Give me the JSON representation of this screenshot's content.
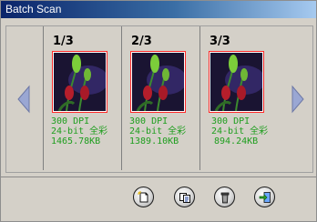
{
  "window": {
    "title": "Batch Scan"
  },
  "scans": [
    {
      "index_label": "1/3",
      "resolution": "300 DPI",
      "color_mode": "24-bit 全彩",
      "file_size": "1465.78KB"
    },
    {
      "index_label": "2/3",
      "resolution": "300 DPI",
      "color_mode": "24-bit 全彩",
      "file_size": "1389.10KB"
    },
    {
      "index_label": "3/3",
      "resolution": "300 DPI",
      "color_mode": "24-bit 全彩",
      "file_size": "894.24KB"
    }
  ],
  "navigation": {
    "prev_icon": "triangle-left-icon",
    "next_icon": "triangle-right-icon"
  },
  "toolbar": {
    "buttons": [
      {
        "icon": "new-document-icon"
      },
      {
        "icon": "copy-icon"
      },
      {
        "icon": "trash-icon"
      },
      {
        "icon": "import-icon"
      }
    ]
  },
  "colors": {
    "title_bar": "#0a246a",
    "info_text": "#1e9e1e",
    "thumbnail_border": "#ff2a2a",
    "nav_arrow": "#9aa7d3"
  }
}
